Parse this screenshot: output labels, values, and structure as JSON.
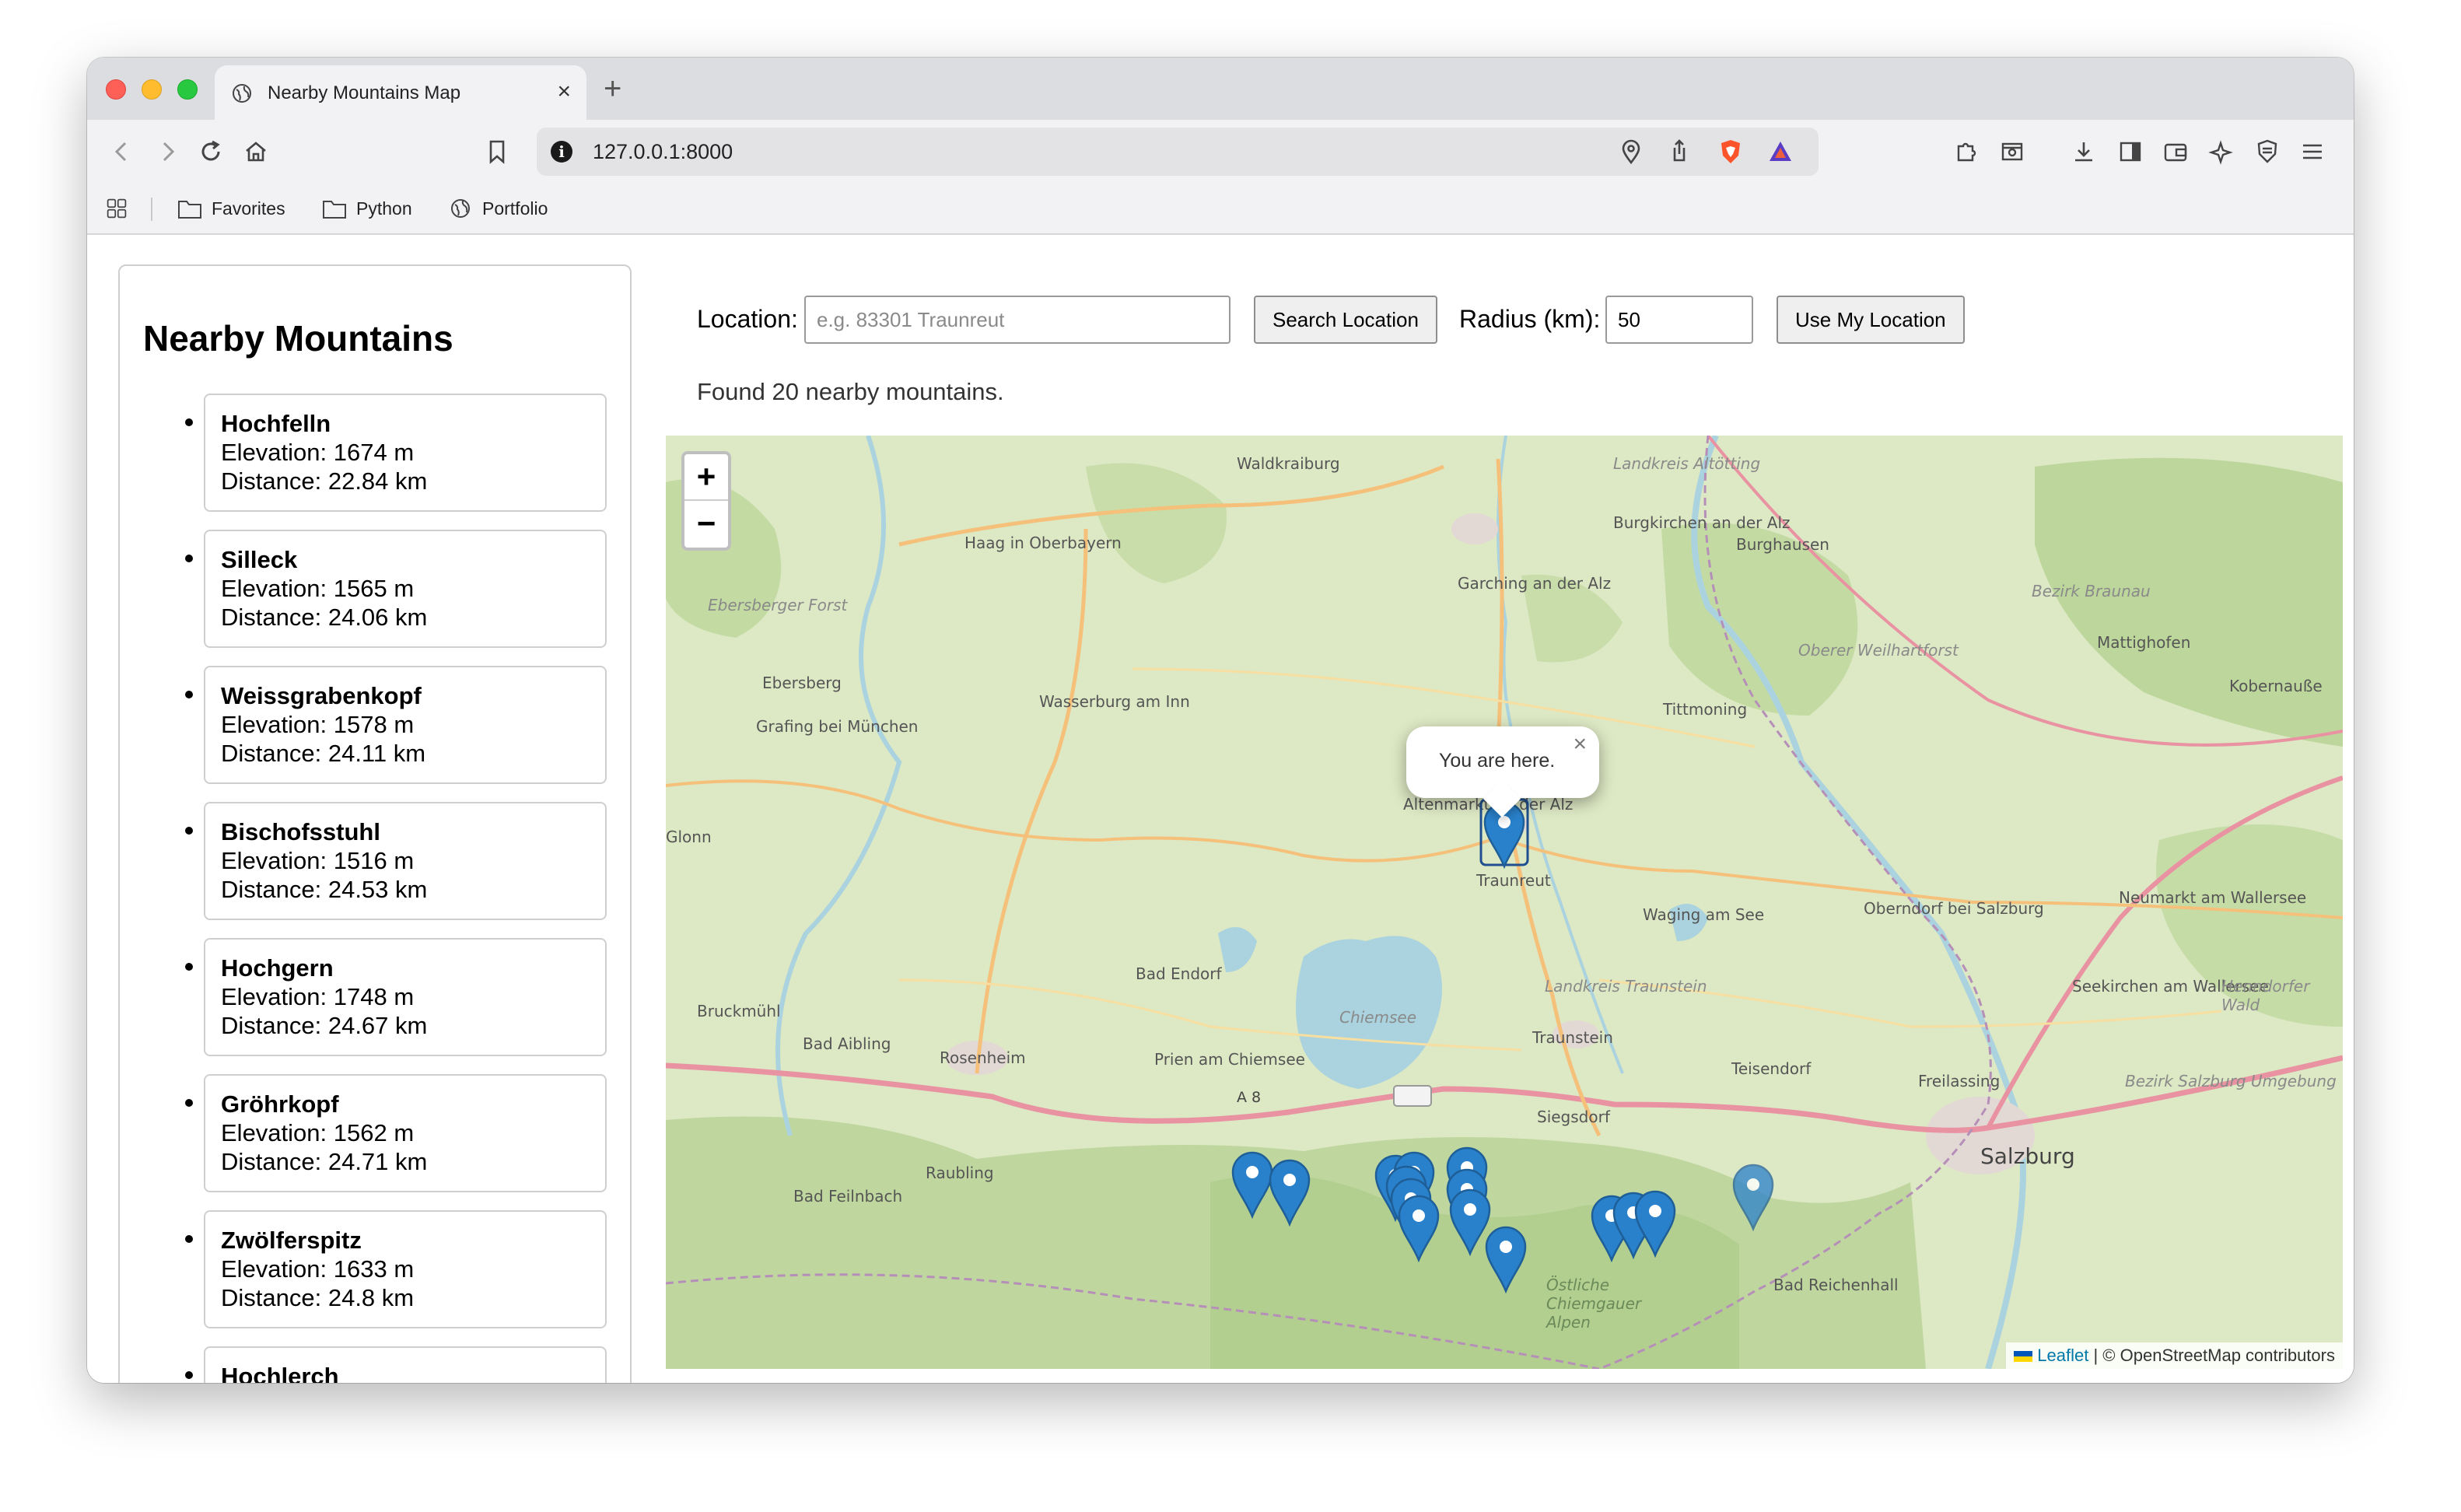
{
  "browser": {
    "tab_title": "Nearby Mountains Map",
    "tab_close": "×",
    "new_tab": "+",
    "url": "127.0.0.1:8000",
    "bookmarks": [
      "Favorites",
      "Python",
      "Portfolio"
    ]
  },
  "sidebar": {
    "title": "Nearby Mountains",
    "mountains": [
      {
        "name": "Hochfelln",
        "elevation": "Elevation: 1674 m",
        "distance": "Distance: 22.84 km"
      },
      {
        "name": "Silleck",
        "elevation": "Elevation: 1565 m",
        "distance": "Distance: 24.06 km"
      },
      {
        "name": "Weissgrabenkopf",
        "elevation": "Elevation: 1578 m",
        "distance": "Distance: 24.11 km"
      },
      {
        "name": "Bischofsstuhl",
        "elevation": "Elevation: 1516 m",
        "distance": "Distance: 24.53 km"
      },
      {
        "name": "Hochgern",
        "elevation": "Elevation: 1748 m",
        "distance": "Distance: 24.67 km"
      },
      {
        "name": "Gröhrkopf",
        "elevation": "Elevation: 1562 m",
        "distance": "Distance: 24.71 km"
      },
      {
        "name": "Zwölferspitz",
        "elevation": "Elevation: 1633 m",
        "distance": "Distance: 24.8 km"
      },
      {
        "name": "Hochlerch",
        "elevation": "",
        "distance": ""
      }
    ]
  },
  "controls": {
    "location_label": "Location:",
    "location_placeholder": "e.g. 83301 Traunreut",
    "search_button": "Search Location",
    "radius_label": "Radius (km):",
    "radius_value": "50",
    "my_location_button": "Use My Location",
    "status": "Found 20 nearby mountains."
  },
  "map": {
    "zoom_in": "+",
    "zoom_out": "−",
    "popup_text": "You are here.",
    "popup_close": "×",
    "attribution_leaflet": "Leaflet",
    "attribution_rest": " | © OpenStreetMap contributors",
    "marker_color": "#2a81cb",
    "place_labels": [
      "Waldkraiburg",
      "Landkreis Altötting",
      "Burgkirchen an der Alz",
      "Burghausen",
      "Haag in Oberbayern",
      "Garching an der Alz",
      "Bezirk Braunau",
      "Ebersberger Forst",
      "Oberer Weilhartforst",
      "Mattighofen",
      "Kobernauße",
      "Ebersberg",
      "Wasserburg am Inn",
      "Tittmoning",
      "Grafing bei München",
      "Altenmarkt an der Alz",
      "Traunreut",
      "Glonn",
      "Waging am See",
      "Oberndorf bei Salzburg",
      "Neumarkt am Wallersee",
      "Bad Endorf",
      "Landkreis Traunstein",
      "Seekirchen am Wallersee",
      "Henndorfer Wald",
      "Bruckmühl",
      "Chiemsee",
      "Traunstein",
      "Bad Aibling",
      "Rosenheim",
      "Prien am Chiemsee",
      "Teisendorf",
      "Freilassing",
      "Bezirk Salzburg Umgebung",
      "A 8",
      "Siegsdorf",
      "Raubling",
      "Bad Feilnbach",
      "Salzburg",
      "Bad Reichenhall",
      "Östliche Chiemgauer Alpen"
    ]
  }
}
